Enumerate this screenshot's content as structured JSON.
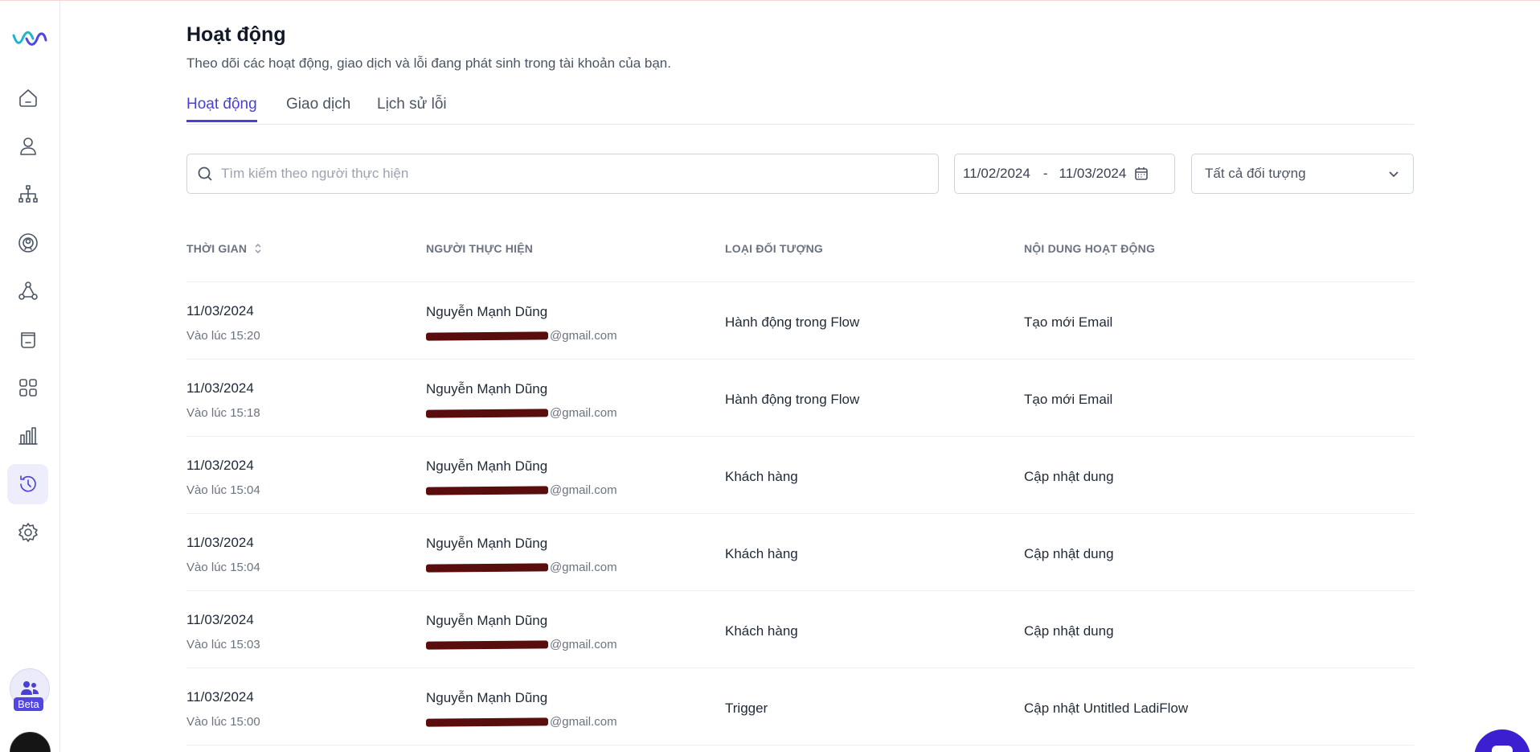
{
  "sidebar": {
    "items": [
      {
        "name": "home",
        "icon": "home-icon"
      },
      {
        "name": "contacts",
        "icon": "user-icon"
      },
      {
        "name": "flow",
        "icon": "sitemap-icon"
      },
      {
        "name": "broadcast",
        "icon": "broadcast-icon"
      },
      {
        "name": "integrations",
        "icon": "nodes-icon"
      },
      {
        "name": "storage",
        "icon": "box-icon"
      },
      {
        "name": "apps",
        "icon": "grid-icon"
      },
      {
        "name": "reports",
        "icon": "bar-chart-icon"
      },
      {
        "name": "activity",
        "icon": "history-icon",
        "active": true
      },
      {
        "name": "settings",
        "icon": "gear-icon"
      }
    ],
    "beta_label": "Beta"
  },
  "header": {
    "title": "Hoạt động",
    "subtitle": "Theo dõi các hoạt động, giao dịch và lỗi đang phát sinh trong tài khoản của bạn."
  },
  "tabs": [
    {
      "label": "Hoạt động",
      "active": true
    },
    {
      "label": "Giao dịch",
      "active": false
    },
    {
      "label": "Lịch sử lỗi",
      "active": false
    }
  ],
  "filters": {
    "search_placeholder": "Tìm kiếm theo người thực hiện",
    "date_from": "11/02/2024",
    "date_separator": "-",
    "date_to": "11/03/2024",
    "object_select": "Tất cả đối tượng"
  },
  "table": {
    "columns": [
      "THỜI GIAN",
      "NGƯỜI THỰC HIỆN",
      "LOẠI ĐỐI TƯỢNG",
      "NỘI DUNG HOẠT ĐỘNG"
    ],
    "rows": [
      {
        "date": "11/03/2024",
        "time": "Vào lúc 15:20",
        "name": "Nguyễn Mạnh Dũng",
        "email_suffix": "@gmail.com",
        "type": "Hành động trong Flow",
        "content": "Tạo mới Email"
      },
      {
        "date": "11/03/2024",
        "time": "Vào lúc 15:18",
        "name": "Nguyễn Mạnh Dũng",
        "email_suffix": "@gmail.com",
        "type": "Hành động trong Flow",
        "content": "Tạo mới Email"
      },
      {
        "date": "11/03/2024",
        "time": "Vào lúc 15:04",
        "name": "Nguyễn Mạnh Dũng",
        "email_suffix": "@gmail.com",
        "type": "Khách hàng",
        "content": "Cập nhật dung"
      },
      {
        "date": "11/03/2024",
        "time": "Vào lúc 15:04",
        "name": "Nguyễn Mạnh Dũng",
        "email_suffix": "@gmail.com",
        "type": "Khách hàng",
        "content": "Cập nhật dung"
      },
      {
        "date": "11/03/2024",
        "time": "Vào lúc 15:03",
        "name": "Nguyễn Mạnh Dũng",
        "email_suffix": "@gmail.com",
        "type": "Khách hàng",
        "content": "Cập nhật dung"
      },
      {
        "date": "11/03/2024",
        "time": "Vào lúc 15:00",
        "name": "Nguyễn Mạnh Dũng",
        "email_suffix": "@gmail.com",
        "type": "Trigger",
        "content": "Cập nhật Untitled LadiFlow"
      }
    ]
  },
  "colors": {
    "accent": "#4a3fd6",
    "redaction": "#5a0d0d"
  }
}
